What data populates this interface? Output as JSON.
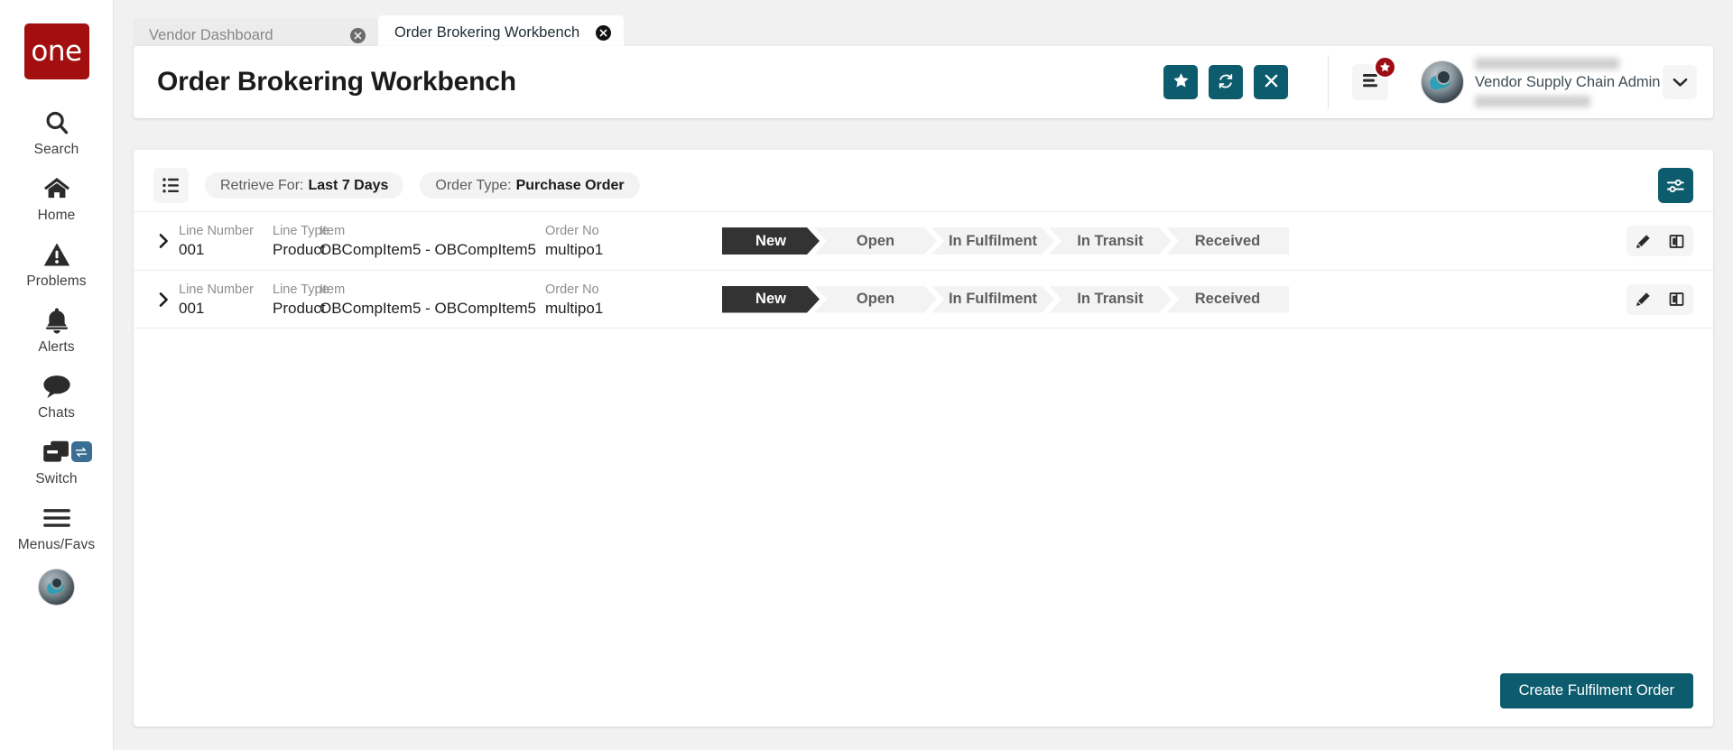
{
  "sidebar": {
    "logo_text": "one",
    "items": [
      {
        "label": "Search",
        "icon": "search-icon"
      },
      {
        "label": "Home",
        "icon": "home-icon"
      },
      {
        "label": "Problems",
        "icon": "warning-triangle-icon"
      },
      {
        "label": "Alerts",
        "icon": "bell-icon"
      },
      {
        "label": "Chats",
        "icon": "chat-bubble-icon"
      },
      {
        "label": "Switch",
        "icon": "windows-stack-icon",
        "badge_icon": "swap-arrows-icon"
      },
      {
        "label": "Menus/Favs",
        "icon": "hamburger-icon"
      }
    ],
    "avatar_icon": "user-avatar"
  },
  "tabs": [
    {
      "label": "Vendor Dashboard",
      "active": false,
      "close_icon": "close-circle-icon"
    },
    {
      "label": "Order Brokering Workbench",
      "active": true,
      "close_icon": "close-circle-icon"
    }
  ],
  "header": {
    "title": "Order Brokering Workbench",
    "actions": [
      {
        "name": "favorite-button",
        "icon": "star-icon"
      },
      {
        "name": "refresh-button",
        "icon": "refresh-icon"
      },
      {
        "name": "close-button",
        "icon": "x-icon"
      }
    ],
    "menu_icon": "menu-lines-icon",
    "menu_badge_icon": "star-icon",
    "user": {
      "role": "Vendor Supply Chain Admin",
      "caret_icon": "chevron-down-icon"
    }
  },
  "filters": {
    "list_toggle_icon": "list-view-icon",
    "settings_icon": "sliders-icon",
    "chips": [
      {
        "label": "Retrieve For:",
        "value": "Last 7 Days"
      },
      {
        "label": "Order Type:",
        "value": "Purchase Order"
      }
    ]
  },
  "table": {
    "field_labels": {
      "line_number": "Line Number",
      "line_type": "Line Type",
      "item": "Item",
      "order_no": "Order No"
    },
    "status_steps": [
      "New",
      "Open",
      "In Fulfilment",
      "In Transit",
      "Received"
    ],
    "rows": [
      {
        "expander_icon": "chevron-right-icon",
        "line_number": "001",
        "line_type": "Product",
        "item": "OBCompItem5 - OBCompItem5",
        "order_no": "multipo1",
        "current_status": "New",
        "actions": [
          {
            "name": "edit-row-button",
            "icon": "pencil-icon"
          },
          {
            "name": "split-view-button",
            "icon": "columns-icon"
          }
        ]
      },
      {
        "expander_icon": "chevron-right-icon",
        "line_number": "001",
        "line_type": "Product",
        "item": "OBCompItem5 - OBCompItem5",
        "order_no": "multipo1",
        "current_status": "New",
        "actions": [
          {
            "name": "edit-row-button",
            "icon": "pencil-icon"
          },
          {
            "name": "split-view-button",
            "icon": "columns-icon"
          }
        ]
      }
    ]
  },
  "footer": {
    "create_label": "Create Fulfilment Order"
  },
  "colors": {
    "accent_teal": "#0d5c6e",
    "logo_red": "#a30f0f",
    "badge_red": "#9c0d13",
    "switch_blue": "#3b6e94",
    "status_active": "#333333",
    "status_inactive": "#f3f3f3",
    "page_bg": "#f1f1f1"
  }
}
